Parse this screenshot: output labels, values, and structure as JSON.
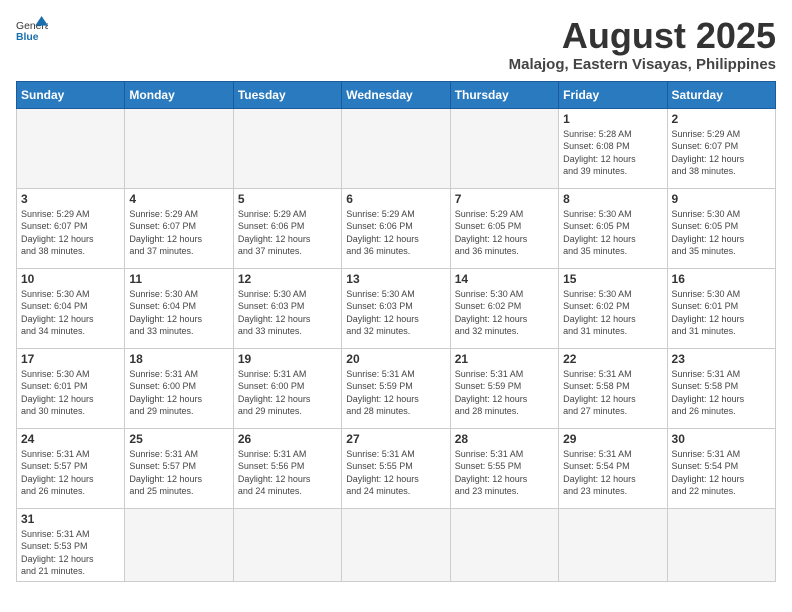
{
  "header": {
    "logo_general": "General",
    "logo_blue": "Blue",
    "title": "August 2025",
    "subtitle": "Malajog, Eastern Visayas, Philippines"
  },
  "weekdays": [
    "Sunday",
    "Monday",
    "Tuesday",
    "Wednesday",
    "Thursday",
    "Friday",
    "Saturday"
  ],
  "weeks": [
    [
      {
        "day": "",
        "info": ""
      },
      {
        "day": "",
        "info": ""
      },
      {
        "day": "",
        "info": ""
      },
      {
        "day": "",
        "info": ""
      },
      {
        "day": "",
        "info": ""
      },
      {
        "day": "1",
        "info": "Sunrise: 5:28 AM\nSunset: 6:08 PM\nDaylight: 12 hours\nand 39 minutes."
      },
      {
        "day": "2",
        "info": "Sunrise: 5:29 AM\nSunset: 6:07 PM\nDaylight: 12 hours\nand 38 minutes."
      }
    ],
    [
      {
        "day": "3",
        "info": "Sunrise: 5:29 AM\nSunset: 6:07 PM\nDaylight: 12 hours\nand 38 minutes."
      },
      {
        "day": "4",
        "info": "Sunrise: 5:29 AM\nSunset: 6:07 PM\nDaylight: 12 hours\nand 37 minutes."
      },
      {
        "day": "5",
        "info": "Sunrise: 5:29 AM\nSunset: 6:06 PM\nDaylight: 12 hours\nand 37 minutes."
      },
      {
        "day": "6",
        "info": "Sunrise: 5:29 AM\nSunset: 6:06 PM\nDaylight: 12 hours\nand 36 minutes."
      },
      {
        "day": "7",
        "info": "Sunrise: 5:29 AM\nSunset: 6:05 PM\nDaylight: 12 hours\nand 36 minutes."
      },
      {
        "day": "8",
        "info": "Sunrise: 5:30 AM\nSunset: 6:05 PM\nDaylight: 12 hours\nand 35 minutes."
      },
      {
        "day": "9",
        "info": "Sunrise: 5:30 AM\nSunset: 6:05 PM\nDaylight: 12 hours\nand 35 minutes."
      }
    ],
    [
      {
        "day": "10",
        "info": "Sunrise: 5:30 AM\nSunset: 6:04 PM\nDaylight: 12 hours\nand 34 minutes."
      },
      {
        "day": "11",
        "info": "Sunrise: 5:30 AM\nSunset: 6:04 PM\nDaylight: 12 hours\nand 33 minutes."
      },
      {
        "day": "12",
        "info": "Sunrise: 5:30 AM\nSunset: 6:03 PM\nDaylight: 12 hours\nand 33 minutes."
      },
      {
        "day": "13",
        "info": "Sunrise: 5:30 AM\nSunset: 6:03 PM\nDaylight: 12 hours\nand 32 minutes."
      },
      {
        "day": "14",
        "info": "Sunrise: 5:30 AM\nSunset: 6:02 PM\nDaylight: 12 hours\nand 32 minutes."
      },
      {
        "day": "15",
        "info": "Sunrise: 5:30 AM\nSunset: 6:02 PM\nDaylight: 12 hours\nand 31 minutes."
      },
      {
        "day": "16",
        "info": "Sunrise: 5:30 AM\nSunset: 6:01 PM\nDaylight: 12 hours\nand 31 minutes."
      }
    ],
    [
      {
        "day": "17",
        "info": "Sunrise: 5:30 AM\nSunset: 6:01 PM\nDaylight: 12 hours\nand 30 minutes."
      },
      {
        "day": "18",
        "info": "Sunrise: 5:31 AM\nSunset: 6:00 PM\nDaylight: 12 hours\nand 29 minutes."
      },
      {
        "day": "19",
        "info": "Sunrise: 5:31 AM\nSunset: 6:00 PM\nDaylight: 12 hours\nand 29 minutes."
      },
      {
        "day": "20",
        "info": "Sunrise: 5:31 AM\nSunset: 5:59 PM\nDaylight: 12 hours\nand 28 minutes."
      },
      {
        "day": "21",
        "info": "Sunrise: 5:31 AM\nSunset: 5:59 PM\nDaylight: 12 hours\nand 28 minutes."
      },
      {
        "day": "22",
        "info": "Sunrise: 5:31 AM\nSunset: 5:58 PM\nDaylight: 12 hours\nand 27 minutes."
      },
      {
        "day": "23",
        "info": "Sunrise: 5:31 AM\nSunset: 5:58 PM\nDaylight: 12 hours\nand 26 minutes."
      }
    ],
    [
      {
        "day": "24",
        "info": "Sunrise: 5:31 AM\nSunset: 5:57 PM\nDaylight: 12 hours\nand 26 minutes."
      },
      {
        "day": "25",
        "info": "Sunrise: 5:31 AM\nSunset: 5:57 PM\nDaylight: 12 hours\nand 25 minutes."
      },
      {
        "day": "26",
        "info": "Sunrise: 5:31 AM\nSunset: 5:56 PM\nDaylight: 12 hours\nand 24 minutes."
      },
      {
        "day": "27",
        "info": "Sunrise: 5:31 AM\nSunset: 5:55 PM\nDaylight: 12 hours\nand 24 minutes."
      },
      {
        "day": "28",
        "info": "Sunrise: 5:31 AM\nSunset: 5:55 PM\nDaylight: 12 hours\nand 23 minutes."
      },
      {
        "day": "29",
        "info": "Sunrise: 5:31 AM\nSunset: 5:54 PM\nDaylight: 12 hours\nand 23 minutes."
      },
      {
        "day": "30",
        "info": "Sunrise: 5:31 AM\nSunset: 5:54 PM\nDaylight: 12 hours\nand 22 minutes."
      }
    ],
    [
      {
        "day": "31",
        "info": "Sunrise: 5:31 AM\nSunset: 5:53 PM\nDaylight: 12 hours\nand 21 minutes."
      },
      {
        "day": "",
        "info": ""
      },
      {
        "day": "",
        "info": ""
      },
      {
        "day": "",
        "info": ""
      },
      {
        "day": "",
        "info": ""
      },
      {
        "day": "",
        "info": ""
      },
      {
        "day": "",
        "info": ""
      }
    ]
  ]
}
